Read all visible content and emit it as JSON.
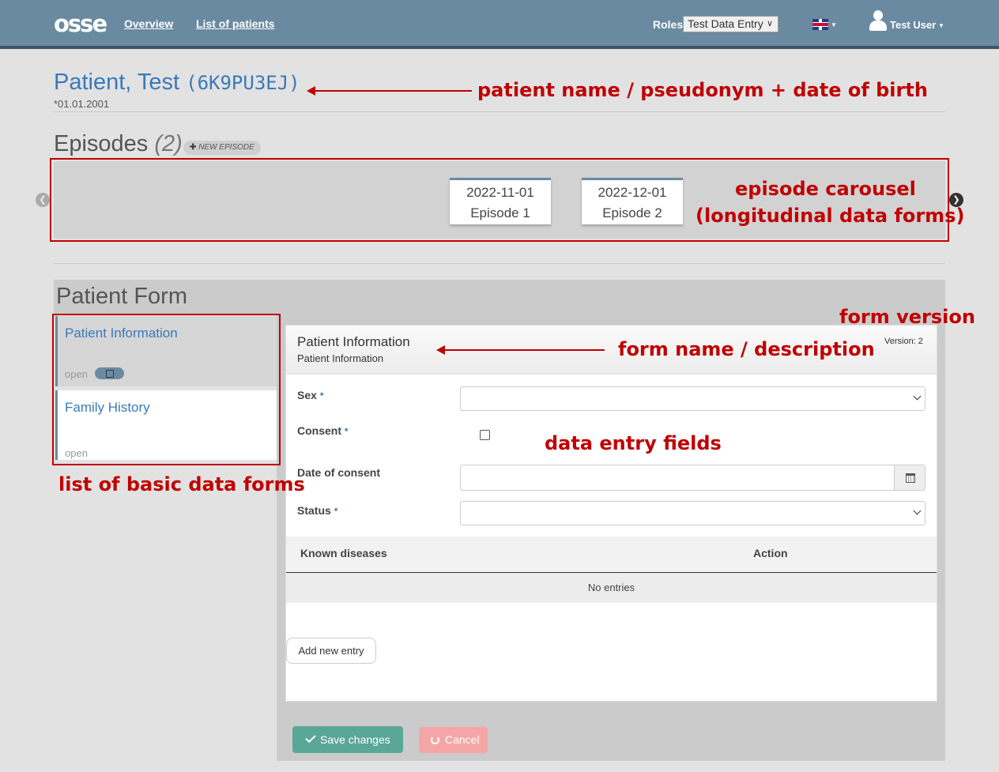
{
  "navbar": {
    "logo": "osse",
    "links": [
      "Overview",
      "List of patients"
    ],
    "roles_label": "Roles",
    "roles_selected": "Test Data Entry",
    "language_icon": "uk-flag-icon",
    "user_icon": "user-icon",
    "user_name": "Test User"
  },
  "patient": {
    "name": "Patient, Test",
    "pseudonym": "(6K9PU3EJ)",
    "dob": "*01.01.2001"
  },
  "episodes": {
    "title": "Episodes",
    "count": "(2)",
    "new_episode_label": "NEW EPISODE",
    "cards": [
      {
        "date": "2022-11-01",
        "label": "Episode 1"
      },
      {
        "date": "2022-12-01",
        "label": "Episode 2"
      }
    ]
  },
  "patient_form": {
    "title": "Patient Form",
    "forms": [
      {
        "name": "Patient Information",
        "status": "open"
      },
      {
        "name": "Family History",
        "status": "open"
      }
    ],
    "card": {
      "title": "Patient Information",
      "description": "Patient Information",
      "version": "Version: 2",
      "fields": [
        {
          "label": "Sex",
          "required": "*"
        },
        {
          "label": "Consent",
          "required": "*"
        },
        {
          "label": "Date of consent",
          "required": ""
        },
        {
          "label": "Status",
          "required": "*"
        }
      ],
      "table": {
        "headers": [
          "Known diseases",
          "Action"
        ],
        "empty_text": "No entries"
      },
      "add_entry_label": "Add new entry"
    },
    "save_label": "Save changes",
    "cancel_label": "Cancel"
  },
  "annotations": {
    "patient_header": "patient name / pseudonym + date of birth",
    "carousel_line1": "episode carousel",
    "carousel_line2": "(longitudinal data forms)",
    "form_version": "form version",
    "form_name": "form name / description",
    "data_fields": "data entry fields",
    "form_list": "list of basic data forms"
  },
  "colors": {
    "navbar": "#6a8aa1",
    "link_blue": "#3a7ab8",
    "annotation_red": "#c00000",
    "save_green": "#5aa797",
    "cancel_pink": "#f4a6a6"
  }
}
